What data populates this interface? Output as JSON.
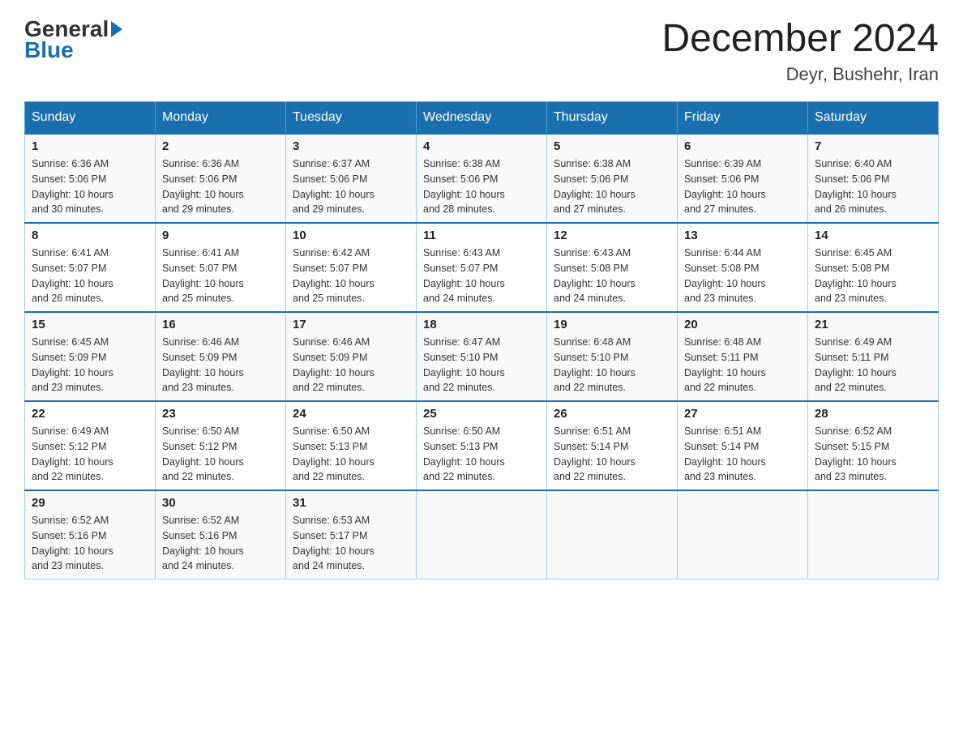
{
  "logo": {
    "general": "General",
    "blue": "Blue"
  },
  "title": "December 2024",
  "subtitle": "Deyr, Bushehr, Iran",
  "headers": [
    "Sunday",
    "Monday",
    "Tuesday",
    "Wednesday",
    "Thursday",
    "Friday",
    "Saturday"
  ],
  "weeks": [
    [
      {
        "day": "1",
        "sunrise": "6:36 AM",
        "sunset": "5:06 PM",
        "daylight": "10 hours and 30 minutes."
      },
      {
        "day": "2",
        "sunrise": "6:36 AM",
        "sunset": "5:06 PM",
        "daylight": "10 hours and 29 minutes."
      },
      {
        "day": "3",
        "sunrise": "6:37 AM",
        "sunset": "5:06 PM",
        "daylight": "10 hours and 29 minutes."
      },
      {
        "day": "4",
        "sunrise": "6:38 AM",
        "sunset": "5:06 PM",
        "daylight": "10 hours and 28 minutes."
      },
      {
        "day": "5",
        "sunrise": "6:38 AM",
        "sunset": "5:06 PM",
        "daylight": "10 hours and 27 minutes."
      },
      {
        "day": "6",
        "sunrise": "6:39 AM",
        "sunset": "5:06 PM",
        "daylight": "10 hours and 27 minutes."
      },
      {
        "day": "7",
        "sunrise": "6:40 AM",
        "sunset": "5:06 PM",
        "daylight": "10 hours and 26 minutes."
      }
    ],
    [
      {
        "day": "8",
        "sunrise": "6:41 AM",
        "sunset": "5:07 PM",
        "daylight": "10 hours and 26 minutes."
      },
      {
        "day": "9",
        "sunrise": "6:41 AM",
        "sunset": "5:07 PM",
        "daylight": "10 hours and 25 minutes."
      },
      {
        "day": "10",
        "sunrise": "6:42 AM",
        "sunset": "5:07 PM",
        "daylight": "10 hours and 25 minutes."
      },
      {
        "day": "11",
        "sunrise": "6:43 AM",
        "sunset": "5:07 PM",
        "daylight": "10 hours and 24 minutes."
      },
      {
        "day": "12",
        "sunrise": "6:43 AM",
        "sunset": "5:08 PM",
        "daylight": "10 hours and 24 minutes."
      },
      {
        "day": "13",
        "sunrise": "6:44 AM",
        "sunset": "5:08 PM",
        "daylight": "10 hours and 23 minutes."
      },
      {
        "day": "14",
        "sunrise": "6:45 AM",
        "sunset": "5:08 PM",
        "daylight": "10 hours and 23 minutes."
      }
    ],
    [
      {
        "day": "15",
        "sunrise": "6:45 AM",
        "sunset": "5:09 PM",
        "daylight": "10 hours and 23 minutes."
      },
      {
        "day": "16",
        "sunrise": "6:46 AM",
        "sunset": "5:09 PM",
        "daylight": "10 hours and 23 minutes."
      },
      {
        "day": "17",
        "sunrise": "6:46 AM",
        "sunset": "5:09 PM",
        "daylight": "10 hours and 22 minutes."
      },
      {
        "day": "18",
        "sunrise": "6:47 AM",
        "sunset": "5:10 PM",
        "daylight": "10 hours and 22 minutes."
      },
      {
        "day": "19",
        "sunrise": "6:48 AM",
        "sunset": "5:10 PM",
        "daylight": "10 hours and 22 minutes."
      },
      {
        "day": "20",
        "sunrise": "6:48 AM",
        "sunset": "5:11 PM",
        "daylight": "10 hours and 22 minutes."
      },
      {
        "day": "21",
        "sunrise": "6:49 AM",
        "sunset": "5:11 PM",
        "daylight": "10 hours and 22 minutes."
      }
    ],
    [
      {
        "day": "22",
        "sunrise": "6:49 AM",
        "sunset": "5:12 PM",
        "daylight": "10 hours and 22 minutes."
      },
      {
        "day": "23",
        "sunrise": "6:50 AM",
        "sunset": "5:12 PM",
        "daylight": "10 hours and 22 minutes."
      },
      {
        "day": "24",
        "sunrise": "6:50 AM",
        "sunset": "5:13 PM",
        "daylight": "10 hours and 22 minutes."
      },
      {
        "day": "25",
        "sunrise": "6:50 AM",
        "sunset": "5:13 PM",
        "daylight": "10 hours and 22 minutes."
      },
      {
        "day": "26",
        "sunrise": "6:51 AM",
        "sunset": "5:14 PM",
        "daylight": "10 hours and 22 minutes."
      },
      {
        "day": "27",
        "sunrise": "6:51 AM",
        "sunset": "5:14 PM",
        "daylight": "10 hours and 23 minutes."
      },
      {
        "day": "28",
        "sunrise": "6:52 AM",
        "sunset": "5:15 PM",
        "daylight": "10 hours and 23 minutes."
      }
    ],
    [
      {
        "day": "29",
        "sunrise": "6:52 AM",
        "sunset": "5:16 PM",
        "daylight": "10 hours and 23 minutes."
      },
      {
        "day": "30",
        "sunrise": "6:52 AM",
        "sunset": "5:16 PM",
        "daylight": "10 hours and 24 minutes."
      },
      {
        "day": "31",
        "sunrise": "6:53 AM",
        "sunset": "5:17 PM",
        "daylight": "10 hours and 24 minutes."
      },
      null,
      null,
      null,
      null
    ]
  ],
  "labels": {
    "sunrise": "Sunrise:",
    "sunset": "Sunset:",
    "daylight": "Daylight:"
  }
}
